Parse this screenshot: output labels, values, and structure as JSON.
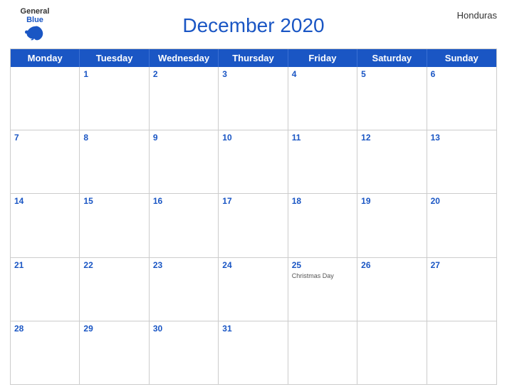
{
  "header": {
    "title": "December 2020",
    "country": "Honduras",
    "logo": {
      "general": "General",
      "blue": "Blue"
    }
  },
  "day_headers": [
    "Monday",
    "Tuesday",
    "Wednesday",
    "Thursday",
    "Friday",
    "Saturday",
    "Sunday"
  ],
  "weeks": [
    [
      {
        "day": "",
        "holiday": ""
      },
      {
        "day": "1",
        "holiday": ""
      },
      {
        "day": "2",
        "holiday": ""
      },
      {
        "day": "3",
        "holiday": ""
      },
      {
        "day": "4",
        "holiday": ""
      },
      {
        "day": "5",
        "holiday": ""
      },
      {
        "day": "6",
        "holiday": ""
      }
    ],
    [
      {
        "day": "7",
        "holiday": ""
      },
      {
        "day": "8",
        "holiday": ""
      },
      {
        "day": "9",
        "holiday": ""
      },
      {
        "day": "10",
        "holiday": ""
      },
      {
        "day": "11",
        "holiday": ""
      },
      {
        "day": "12",
        "holiday": ""
      },
      {
        "day": "13",
        "holiday": ""
      }
    ],
    [
      {
        "day": "14",
        "holiday": ""
      },
      {
        "day": "15",
        "holiday": ""
      },
      {
        "day": "16",
        "holiday": ""
      },
      {
        "day": "17",
        "holiday": ""
      },
      {
        "day": "18",
        "holiday": ""
      },
      {
        "day": "19",
        "holiday": ""
      },
      {
        "day": "20",
        "holiday": ""
      }
    ],
    [
      {
        "day": "21",
        "holiday": ""
      },
      {
        "day": "22",
        "holiday": ""
      },
      {
        "day": "23",
        "holiday": ""
      },
      {
        "day": "24",
        "holiday": ""
      },
      {
        "day": "25",
        "holiday": "Christmas Day"
      },
      {
        "day": "26",
        "holiday": ""
      },
      {
        "day": "27",
        "holiday": ""
      }
    ],
    [
      {
        "day": "28",
        "holiday": ""
      },
      {
        "day": "29",
        "holiday": ""
      },
      {
        "day": "30",
        "holiday": ""
      },
      {
        "day": "31",
        "holiday": ""
      },
      {
        "day": "",
        "holiday": ""
      },
      {
        "day": "",
        "holiday": ""
      },
      {
        "day": "",
        "holiday": ""
      }
    ]
  ]
}
